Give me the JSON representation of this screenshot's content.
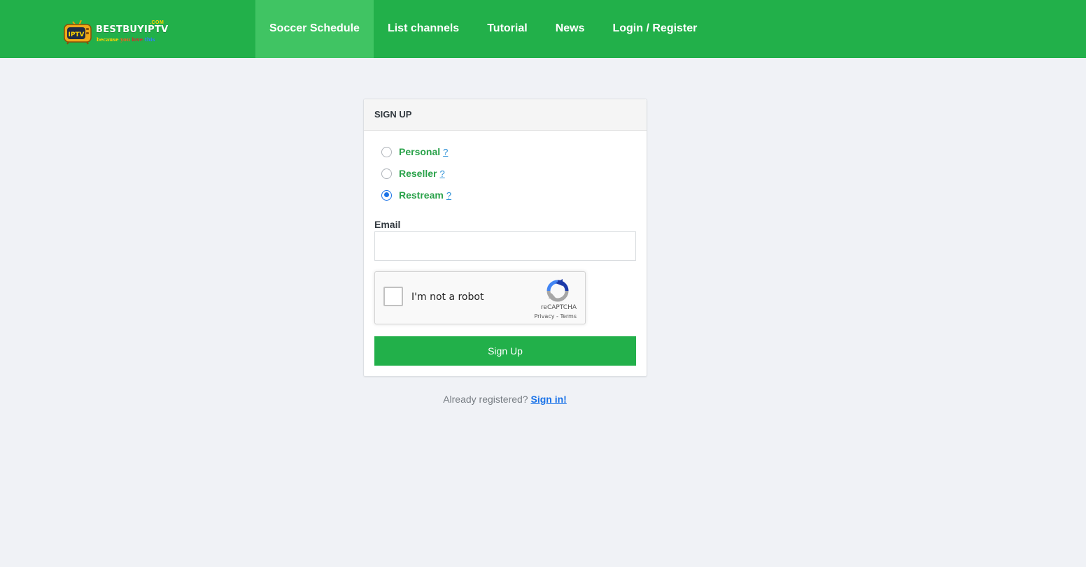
{
  "brand": {
    "name": "BESTBUYIPTV",
    "com": ".COM",
    "tv_text": "IPTV",
    "tagline_pre": "because",
    "tagline_you": "you",
    "tagline_love": "love",
    "tagline_this": "this",
    "primary_color": "#22b04a",
    "active_tab_color": "#40c463"
  },
  "nav": {
    "items": [
      {
        "label": "Soccer Schedule",
        "active": true
      },
      {
        "label": "List channels",
        "active": false
      },
      {
        "label": "Tutorial",
        "active": false
      },
      {
        "label": "News",
        "active": false
      },
      {
        "label": "Login / Register",
        "active": false
      }
    ]
  },
  "signup": {
    "title": "SIGN UP",
    "account_types": [
      {
        "label": "Personal",
        "help": "?",
        "checked": false
      },
      {
        "label": "Reseller",
        "help": "?",
        "checked": false
      },
      {
        "label": "Restream",
        "help": "?",
        "checked": true
      }
    ],
    "email_label": "Email",
    "email_value": "",
    "captcha": {
      "text": "I'm not a robot",
      "brand": "reCAPTCHA",
      "privacy": "Privacy",
      "separator": " - ",
      "terms": "Terms"
    },
    "submit_label": "Sign Up"
  },
  "footer": {
    "prompt": "Already registered?",
    "link": "Sign in!"
  }
}
